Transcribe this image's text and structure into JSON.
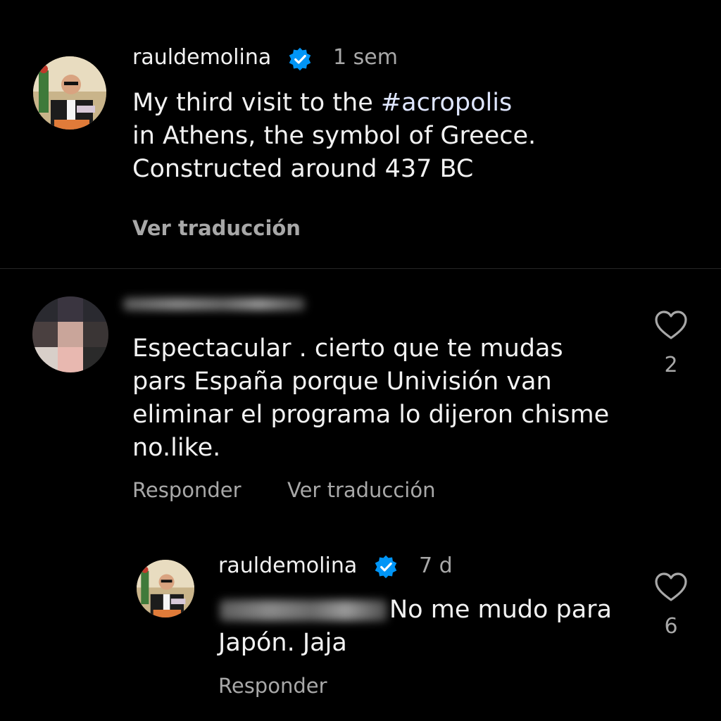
{
  "post": {
    "username": "rauldemolina",
    "time": "1 sem",
    "caption_before": "My third visit to the ",
    "hashtag": "#acropolis",
    "caption_line2": "in Athens, the symbol of Greece.",
    "caption_line3": "Constructed around 437 BC",
    "translate_label": "Ver traducción"
  },
  "comment": {
    "username": "",
    "text_line1": "Espectacular . cierto que te mudas",
    "text_line2": "pars España porque Univisión van",
    "text_line3": "eliminar el programa lo dijeron chisme",
    "text_line4": "no.like.",
    "like_count": "2",
    "reply_label": "Responder",
    "translate_label": "Ver traducción"
  },
  "reply": {
    "username": "rauldemolina",
    "time": "7 d",
    "text_line1": "No me mudo para",
    "text_line2": "Japón. Jaja",
    "like_count": "6",
    "reply_label": "Responder"
  },
  "icons": {
    "verified": "verified-badge-icon",
    "like": "heart-icon"
  },
  "colors": {
    "background": "#000000",
    "verified_blue": "#0095f6",
    "secondary_text": "#a8a8a8"
  }
}
